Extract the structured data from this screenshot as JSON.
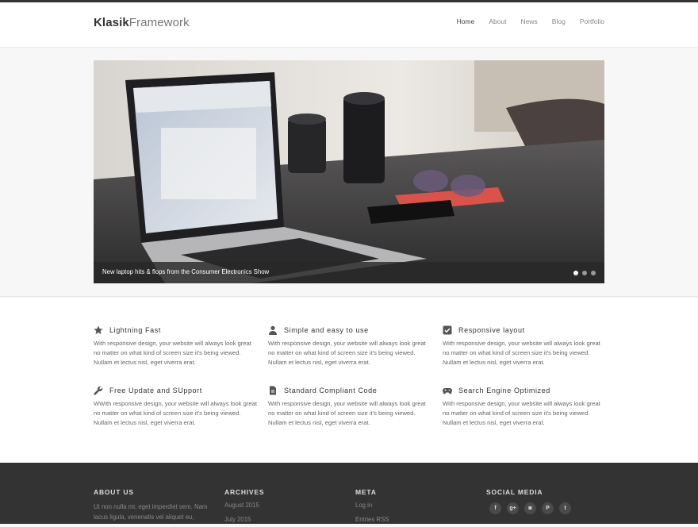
{
  "brand": {
    "bold": "Klasik",
    "regular": "Framework"
  },
  "nav": [
    {
      "label": "Home",
      "active": true
    },
    {
      "label": "About"
    },
    {
      "label": "News"
    },
    {
      "label": "Blog"
    },
    {
      "label": "Portfolio"
    }
  ],
  "slider": {
    "caption": "New laptop hits & flops from the Consumer Electronics Show",
    "dots": 3,
    "active_dot": 0
  },
  "features": [
    {
      "icon": "star-icon",
      "title": "Lightning Fast",
      "text": "With responsive design, your website will always look great no matter on what kind of screen size it's being viewed. Nullam et lectus nisl, eget viverra erat."
    },
    {
      "icon": "user-icon",
      "title": "Simple and easy to use",
      "text": "With responsive design, your website will always look great no matter on what kind of screen size it's being viewed. Nullam et lectus nisl, eget viverra erat."
    },
    {
      "icon": "check-square-icon",
      "title": "Responsive layout",
      "text": "With responsive design, your website will always look great no matter on what kind of screen size it's being viewed. Nullam et lectus nisl, eget viverra erat."
    },
    {
      "icon": "wrench-icon",
      "title": "Free Update and SUpport",
      "text": "WWith responsive design, your website will always look great no matter on what kind of screen size it's being viewed. Nullam et lectus nisl, eget viverra erat."
    },
    {
      "icon": "document-icon",
      "title": "Standard Compliant Code",
      "text": "With responsive design, your website will always look great no matter on what kind of screen size it's being viewed. Nullam et lectus nisl, eget viverra erat."
    },
    {
      "icon": "gamepad-icon",
      "title": "Search Engine Optimized",
      "text": "With responsive design, your website will always look great no matter on what kind of screen size it's being viewed. Nullam et lectus nisl, eget viverra erat."
    }
  ],
  "footer": {
    "about": {
      "heading": "ABOUT US",
      "text": "Ut non nulla mi, eget imperdiet sem. Nam lacus ligula, venenatis vel aliquet eu,"
    },
    "archives": {
      "heading": "ARCHIVES",
      "items": [
        "August 2015",
        "July 2015"
      ]
    },
    "meta": {
      "heading": "META",
      "items": [
        "Log in",
        "Entries RSS"
      ]
    },
    "social": {
      "heading": "SOCIAL MEDIA",
      "icons": [
        {
          "name": "facebook-icon",
          "glyph": "f"
        },
        {
          "name": "google-plus-icon",
          "glyph": "g+"
        },
        {
          "name": "instagram-icon",
          "glyph": "◙"
        },
        {
          "name": "pinterest-icon",
          "glyph": "P"
        },
        {
          "name": "twitter-icon",
          "glyph": "t"
        }
      ]
    }
  }
}
